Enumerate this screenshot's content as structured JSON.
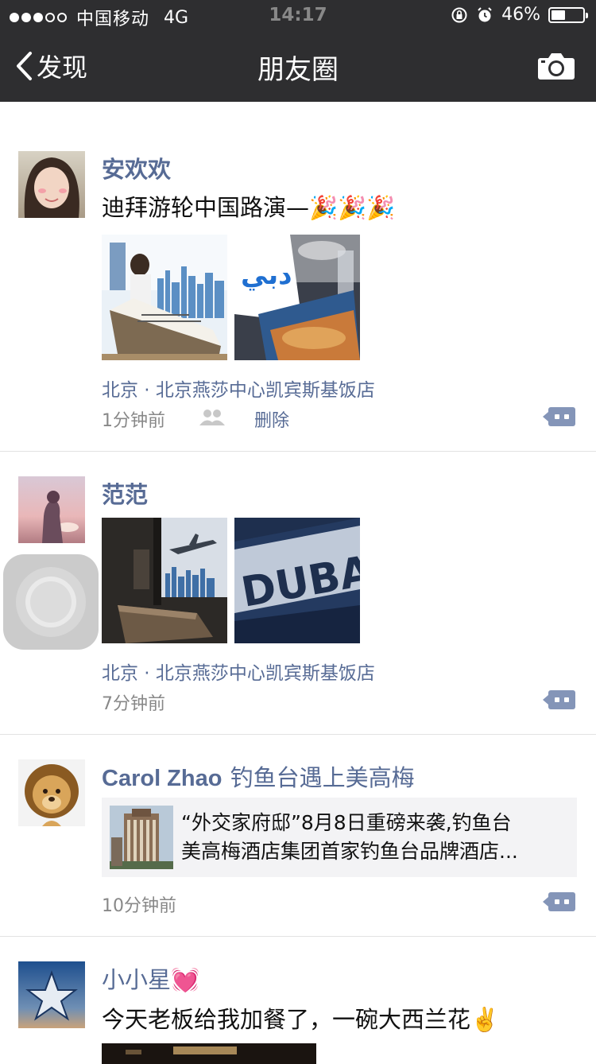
{
  "status_bar": {
    "signal": "●●●○○",
    "carrier": "中国移动",
    "network": "4G",
    "time": "14:17",
    "battery_percent": "46%",
    "battery_level": 0.46
  },
  "nav": {
    "back_label": "发现",
    "title": "朋友圈",
    "camera_icon": "camera-icon"
  },
  "posts": [
    {
      "author": "安欢欢",
      "text": "迪拜游轮中国路演—",
      "emoji": "🎉🎉🎉",
      "photo_count": 2,
      "location": "北京 · 北京燕莎中心凯宾斯基饭店",
      "time": "1分钟前",
      "delete_label": "删除"
    },
    {
      "author": "范范",
      "photo_count": 2,
      "location": "北京 · 北京燕莎中心凯宾斯基饭店",
      "time": "7分钟前"
    },
    {
      "author": "Carol Zhao",
      "text": "钓鱼台遇上美高梅",
      "link_line1": "“外交家府邸”8月8日重磅来袭,钓鱼台",
      "link_line2": "美高梅酒店集团首家钓鱼台品牌酒店...",
      "time": "10分钟前"
    },
    {
      "author": "小小星",
      "author_emoji": "💓",
      "text": "今天老板给我加餐了，一碗大西兰花",
      "emoji": "✌️"
    }
  ]
}
